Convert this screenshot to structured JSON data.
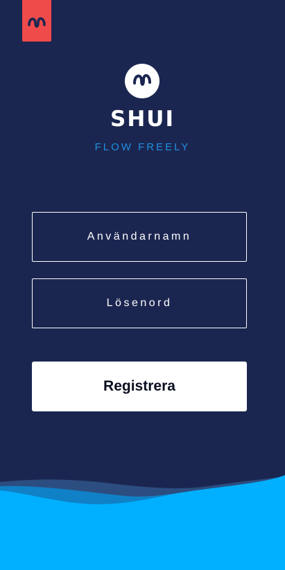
{
  "brand": {
    "name": "SHUI",
    "tagline": "FLOW FREELY",
    "logo_icon": "shui-s-logo-icon",
    "corner_icon": "shui-s-logo-icon"
  },
  "form": {
    "username_placeholder": "Användarnamn",
    "password_placeholder": "Lösenord",
    "submit_label": "Registrera"
  },
  "colors": {
    "background": "#1b2650",
    "accent_red": "#ef4b4b",
    "tagline_blue": "#1f8fe0",
    "wave_blue": "#00b0ff"
  }
}
